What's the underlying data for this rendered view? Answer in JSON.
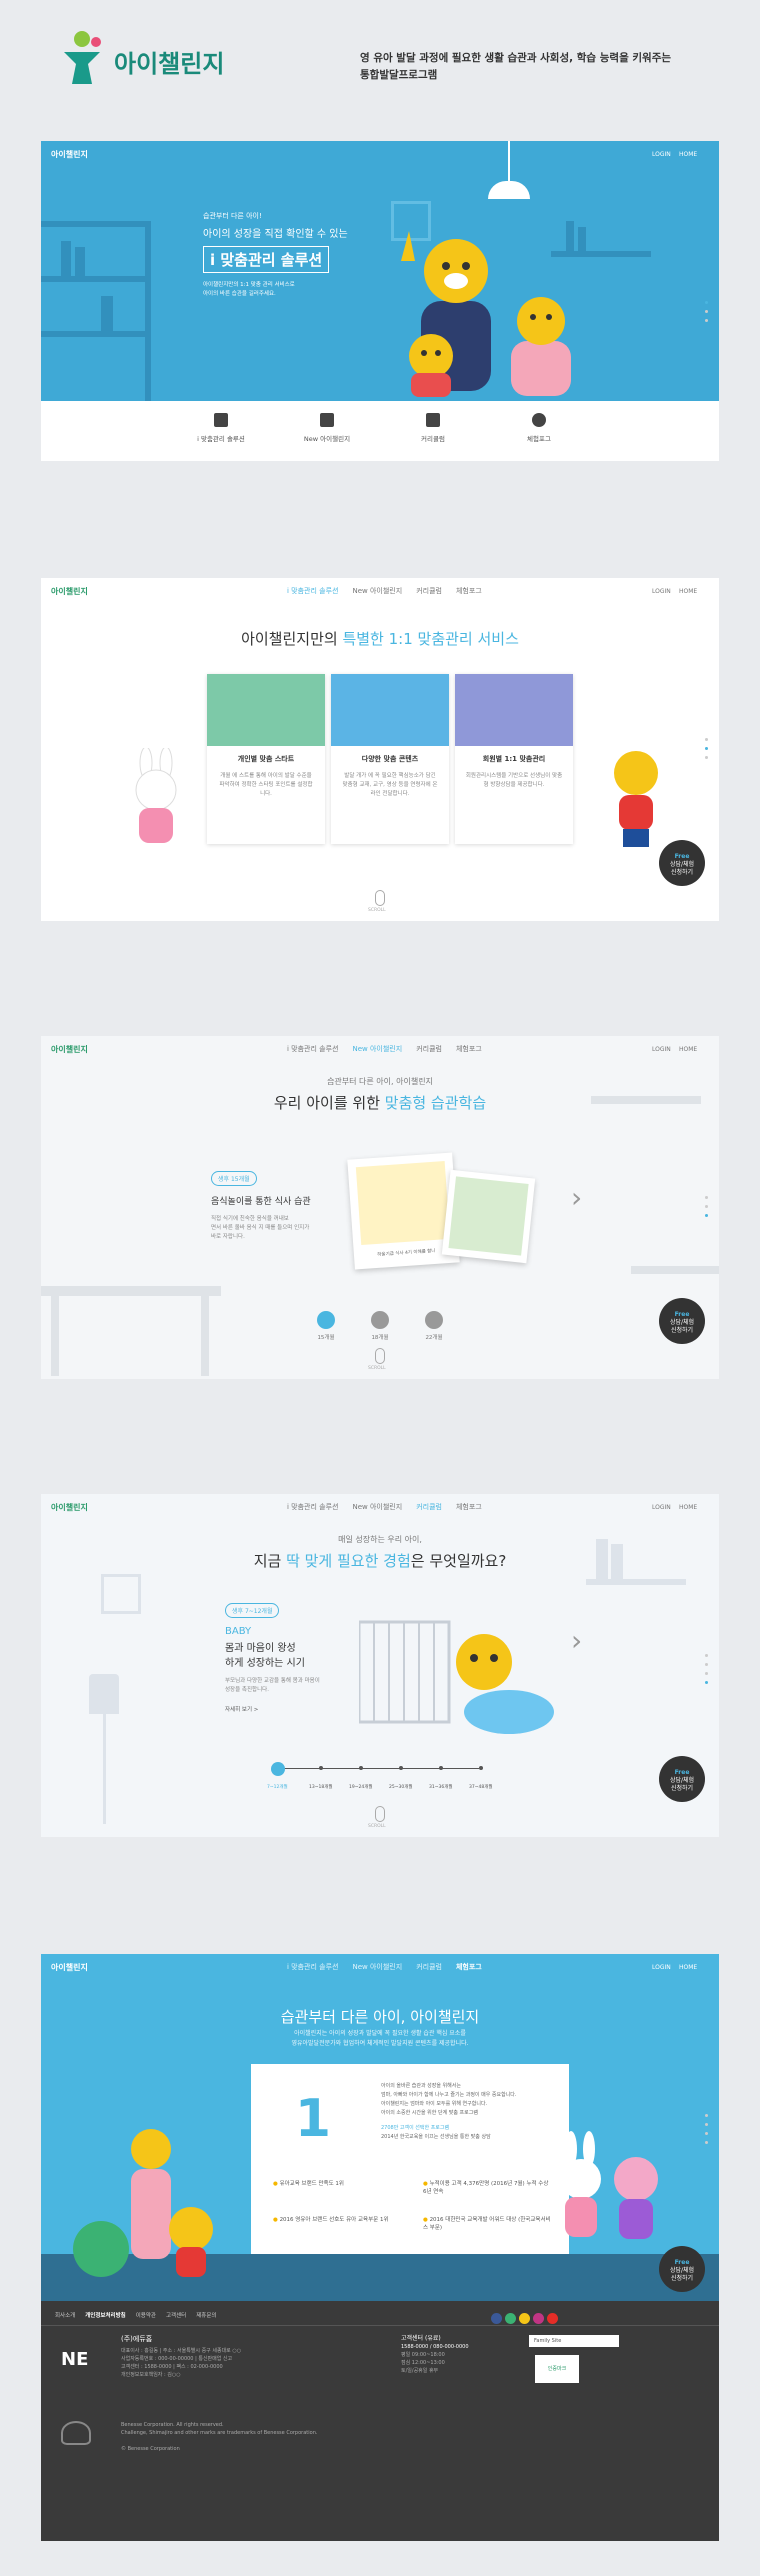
{
  "header": {
    "logo_text": "아이챌린지",
    "desc_line1": "영 유아 발달 과정에 필요한 생활 습관과 사회성, 학습 능력을 키워주는",
    "desc_line2": "통합발달프로그램"
  },
  "common": {
    "mini_logo": "아이챌린지",
    "login": "LOGIN",
    "home": "HOME",
    "chat_line1": "Free",
    "chat_line2": "상담/체험",
    "chat_line3": "신청하기",
    "scroll_label": "SCROLL",
    "nav": [
      "i 맞춤관리 솔루션",
      "New 아이챌린지",
      "커리큘럼",
      "체험포그"
    ]
  },
  "hero": {
    "eyebrow": "습관부터 다른 아이!",
    "line1": "아이의 성장을 직접 확인할 수 있는",
    "title": "i 맞춤관리 솔루션",
    "desc1": "아이챌린지만의 1:1 맞춤 관리 서비스로",
    "desc2": "아이의 바른 습관을 길러주세요.",
    "tabs": [
      "i 맞춤관리 솔루션",
      "New 아이챌린지",
      "커리큘럼",
      "체험포그"
    ]
  },
  "service": {
    "title_pre": "아이챌린지만의 ",
    "title_hl": "특별한 1:1 맞춤관리 서비스",
    "cards": [
      {
        "title": "개인별 맞춤 스타트",
        "desc": "개월 에 스트를 통해 아이의 발달 수준을 파악하여 정확한 스타팅 포인트를 설정합니다."
      },
      {
        "title": "다양한 맞춤 콘텐츠",
        "desc": "발달 개가 에 꼭 필요한 핵심능소가 담긴 맞춤형 교재, 교구, 영상 등을 연령자에 온라인 전달합니다."
      },
      {
        "title": "회원별 1:1 맞춤관리",
        "desc": "회원관리시스템을 기반으로 선생님이 맞춤형 방향상담을 제공합니다."
      }
    ]
  },
  "learning": {
    "eyebrow": "습관부터 다른 아이, 아이챌린지",
    "title_pre": "우리 아이를 위한 ",
    "title_hl": "맞춤형 습관학습",
    "badge": "생후 15개월",
    "item_title": "음식놀이를 통한 식사 습관",
    "item_desc1": "직접 식기에 친숙한 음식을 꺼내보",
    "item_desc2": "면서 바른 올바 음식 지 때를 들으며 인지가",
    "item_desc3": "바로 자랍니다.",
    "caption": "하울기급 식사 4기 이해를 합니",
    "steps": [
      "15개월",
      "18개월",
      "22개월"
    ]
  },
  "curriculum": {
    "eyebrow": "매일 성장하는 우리 아이,",
    "title_pre": "지금 ",
    "title_hl": "딱 맞게 필요한 경험",
    "title_post": "은 무엇일까요?",
    "badge": "생후 7~12개월",
    "stage": "BABY",
    "head1": "몸과 마음이 왕성",
    "head2": "하게 성장하는 시기",
    "desc1": "부모님과 다양한 교감을 통해 몸과 마음이",
    "desc2": "성장을 촉진합니다.",
    "more": "자세히 보기 >",
    "timeline": [
      "7~12개월",
      "13~18개월",
      "19~24개월",
      "25~30개월",
      "31~36개월",
      "37~48개월"
    ]
  },
  "award": {
    "title": "습관부터 다른 아이, 아이챌린지",
    "desc1": "아이챌린지는 아이의 성장과 발달에 꼭 필요한 생활 습관 핵심 요소를",
    "desc2": "영유아발달전문가와 협업하여 체계적인 발달지원 콘텐츠를 제공합니다.",
    "big_num": "1",
    "text1": "아이의 올바른 습관과 성장을 위해서는",
    "text2": "엄마, 아빠와 아이가 함께 나누고 즐기는 과정이 매우 중요합니다.",
    "text3": "아이챌린지는 엄마와 아이 모두를 위해 연구합니다.",
    "text4": "아이의 소중한 시간을 위한 단계 맞춤 프로그램",
    "hl1": "2708만 고객이 선택한 프로그램",
    "hl2": "2014년 한국교육을 이끄는 선생님을 통한 맞춤 상담",
    "awards": [
      "유아교육 브랜드 만족도 1위",
      "누적이용 고객 4,376만명 (2016년 7월) 누적 수상 6년 연속",
      "2016 영유아 브랜드 선호도 유아 교육부문 1위",
      "2016 대한민국 교육개발 어워드 대상 (한국교육서비스 부문)"
    ]
  },
  "footer": {
    "links": [
      "회사소개",
      "개인정보처리방침",
      "이용약관",
      "고객센터",
      "제휴문의"
    ],
    "company_name": "(주)에듀홈",
    "company_info1": "대표이사 : 홍길동 | 주소 : 서울특별시 중구 세종대로 ○○",
    "company_info2": "사업자등록번호 : 000-00-00000 | 통신판매업 신고",
    "company_info3": "고객센터 : 1588-0000 | 팩스 : 02-000-0000",
    "company_info4": "개인정보보호책임자 : 김○○",
    "cs_title": "고객센터 (유료)",
    "cs_phone": "1588-0000 / 080-000-0000",
    "cs_hours": "평일 09:00~18:00",
    "cs_lunch": "점심 12:00~13:00",
    "cs_closed": "토/일/공휴일 휴무",
    "family_site": "Family Site",
    "cert_text": "인증마크",
    "copyright1": "Benesse Corporation. All rights reserved.",
    "copyright2": "Challenge, Shimajiro and other marks are trademarks of Benesse Corporation.",
    "copyright3": "© Benesse Corporation",
    "ne_logo": "NE"
  },
  "colors": {
    "accent": "#4ab6e0",
    "hero_bg": "#3fa9d6",
    "footer_bg": "#3a3a3a",
    "tiger": "#f5c518"
  },
  "icons": [
    "person-icon",
    "book-icon",
    "calendar-icon",
    "chat-icon",
    "chevron-right-icon",
    "apple-icon",
    "cup-icon",
    "medal-icon",
    "mouse-scroll-icon"
  ]
}
